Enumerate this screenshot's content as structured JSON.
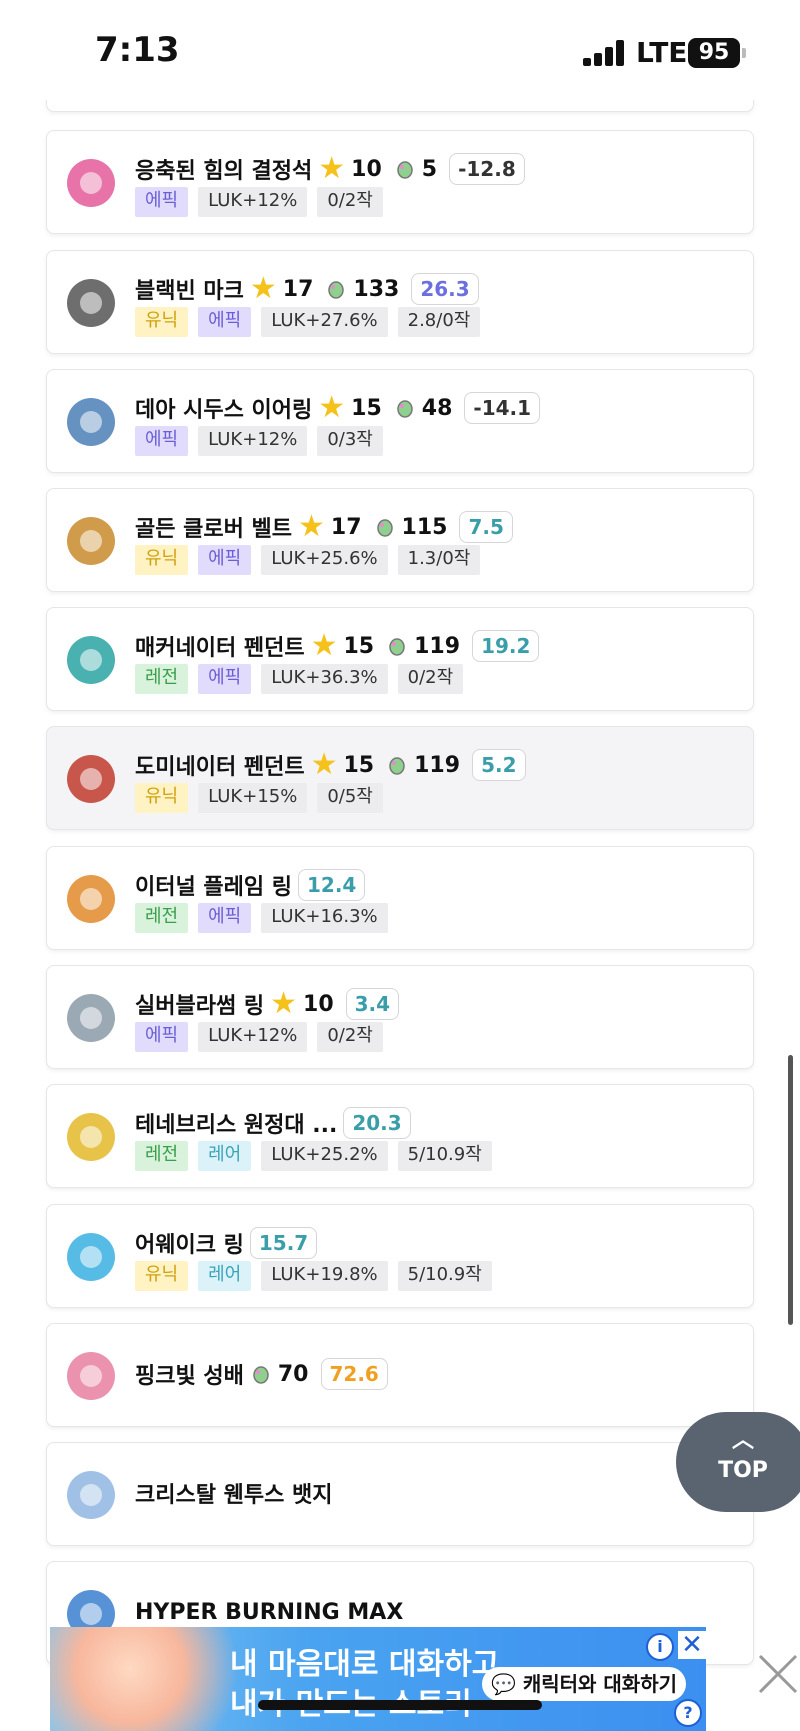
{
  "status_bar": {
    "time": "7:13",
    "network": "LTE",
    "battery": "95"
  },
  "items": [
    {
      "name": "응축된 힘의 결정석",
      "stars": "10",
      "gems": "5",
      "score": "-12.8",
      "score_color": "#333333",
      "tags": [
        {
          "text": "에픽",
          "kind": "epic"
        },
        {
          "text": "LUK+12%",
          "kind": "gray"
        },
        {
          "text": "0/2작",
          "kind": "gray"
        }
      ],
      "icon": "crystal-stone-icon"
    },
    {
      "name": "블랙빈 마크",
      "stars": "17",
      "gems": "133",
      "score": "26.3",
      "score_color": "#6b6fe0",
      "tags": [
        {
          "text": "유닉",
          "kind": "unique"
        },
        {
          "text": "에픽",
          "kind": "epic"
        },
        {
          "text": "LUK+27.6%",
          "kind": "gray"
        },
        {
          "text": "2.8/0작",
          "kind": "gray"
        }
      ],
      "icon": "black-bean-mark-icon"
    },
    {
      "name": "데아 시두스 이어링",
      "stars": "15",
      "gems": "48",
      "score": "-14.1",
      "score_color": "#333333",
      "tags": [
        {
          "text": "에픽",
          "kind": "epic"
        },
        {
          "text": "LUK+12%",
          "kind": "gray"
        },
        {
          "text": "0/3작",
          "kind": "gray"
        }
      ],
      "icon": "earring-icon"
    },
    {
      "name": "골든 클로버 벨트",
      "stars": "17",
      "gems": "115",
      "score": "7.5",
      "score_color": "#3a9eaa",
      "tags": [
        {
          "text": "유닉",
          "kind": "unique"
        },
        {
          "text": "에픽",
          "kind": "epic"
        },
        {
          "text": "LUK+25.6%",
          "kind": "gray"
        },
        {
          "text": "1.3/0작",
          "kind": "gray"
        }
      ],
      "icon": "belt-icon"
    },
    {
      "name": "매커네이터 펜던트",
      "stars": "15",
      "gems": "119",
      "score": "19.2",
      "score_color": "#3a9eaa",
      "tags": [
        {
          "text": "레전",
          "kind": "legend"
        },
        {
          "text": "에픽",
          "kind": "epic"
        },
        {
          "text": "LUK+36.3%",
          "kind": "gray"
        },
        {
          "text": "0/2작",
          "kind": "gray"
        }
      ],
      "icon": "pendant-icon"
    },
    {
      "name": "도미네이터 펜던트",
      "stars": "15",
      "gems": "119",
      "score": "5.2",
      "score_color": "#3a9eaa",
      "tags": [
        {
          "text": "유닉",
          "kind": "unique"
        },
        {
          "text": "LUK+15%",
          "kind": "gray"
        },
        {
          "text": "0/5작",
          "kind": "gray"
        }
      ],
      "icon": "red-pendant-icon"
    },
    {
      "name": "이터널 플레임 링",
      "stars": "",
      "gems": "",
      "score": "12.4",
      "score_color": "#3a9eaa",
      "tags": [
        {
          "text": "레전",
          "kind": "legend"
        },
        {
          "text": "에픽",
          "kind": "epic"
        },
        {
          "text": "LUK+16.3%",
          "kind": "gray"
        }
      ],
      "icon": "flame-ring-icon"
    },
    {
      "name": "실버블라썸 링",
      "stars": "10",
      "gems": "",
      "score": "3.4",
      "score_color": "#3a9eaa",
      "tags": [
        {
          "text": "에픽",
          "kind": "epic"
        },
        {
          "text": "LUK+12%",
          "kind": "gray"
        },
        {
          "text": "0/2작",
          "kind": "gray"
        }
      ],
      "icon": "silver-ring-icon"
    },
    {
      "name": "테네브리스 원정대 ...",
      "stars": "",
      "gems": "",
      "score": "20.3",
      "score_color": "#3a9eaa",
      "tags": [
        {
          "text": "레전",
          "kind": "legend"
        },
        {
          "text": "레어",
          "kind": "rare"
        },
        {
          "text": "LUK+25.2%",
          "kind": "gray"
        },
        {
          "text": "5/10.9작",
          "kind": "gray"
        }
      ],
      "icon": "gold-ring-icon"
    },
    {
      "name": "어웨이크 링",
      "stars": "",
      "gems": "",
      "score": "15.7",
      "score_color": "#3a9eaa",
      "tags": [
        {
          "text": "유닉",
          "kind": "unique"
        },
        {
          "text": "레어",
          "kind": "rare"
        },
        {
          "text": "LUK+19.8%",
          "kind": "gray"
        },
        {
          "text": "5/10.9작",
          "kind": "gray"
        }
      ],
      "icon": "awake-ring-icon"
    },
    {
      "name": "핑크빛 성배",
      "stars": "",
      "gems": "70",
      "score": "72.6",
      "score_color": "#f0a020",
      "tags": [],
      "icon": "pink-chalice-icon"
    },
    {
      "name": "크리스탈 웬투스 뱃지",
      "stars": "",
      "gems": "",
      "score": "",
      "score_color": "#3a9eaa",
      "tags": [],
      "icon": "crystal-badge-icon"
    },
    {
      "name": "HYPER BURNING MAX",
      "stars": "",
      "gems": "",
      "score": "",
      "score_color": "#3a9eaa",
      "tags": [],
      "icon": "hyper-burning-icon"
    }
  ],
  "top_button": {
    "label": "TOP"
  },
  "ad": {
    "line1": "내 마음대로 대화하고",
    "line2": "내가 만드는 스토리",
    "cta": "캐릭터와 대화하기"
  },
  "colors": {
    "star": "#f5c21b",
    "epic": "#6b5fd6",
    "unique": "#d1a00f",
    "legend": "#3a9e4a",
    "rare": "#3aa3b8"
  }
}
